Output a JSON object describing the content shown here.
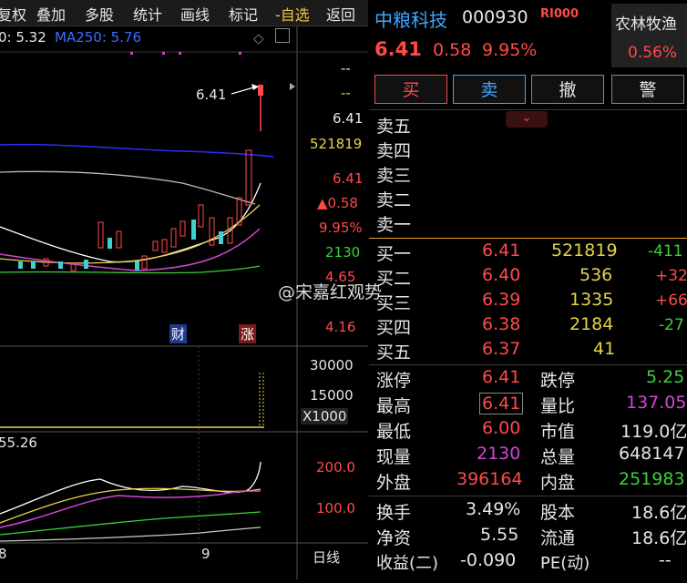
{
  "toolbar": {
    "items": [
      "复权",
      "叠加",
      "多股",
      "统计",
      "画线",
      "标记",
      "-自选",
      "返回"
    ]
  },
  "ma_legend": {
    "ma_partial": "0: 5.32",
    "ma250": "MA250: 5.76"
  },
  "price_axis": [
    "--",
    "--",
    "6.41",
    "521819",
    "6.41",
    "▲0.58",
    "9.95%",
    "2130",
    "4.65",
    "4.16"
  ],
  "kline": {
    "peak_label": "6.41",
    "badge_cai": "财",
    "badge_zhang": "涨"
  },
  "volume_axis": [
    "30000",
    "15000",
    "X1000"
  ],
  "indicator": {
    "value": "55.26",
    "axis": [
      "200.0",
      "100.0"
    ]
  },
  "x_axis": {
    "left": "8",
    "mid": "9",
    "period": "日线"
  },
  "stock": {
    "name": "中粮科技",
    "code": "000930",
    "flag": "R",
    "price": "6.41",
    "change": "0.58",
    "change_pct": "9.95%",
    "sector": "农林牧渔",
    "sector_pct": "0.56%"
  },
  "actions": [
    "买",
    "卖",
    "撤",
    "警"
  ],
  "sell_book": [
    "卖五",
    "卖四",
    "卖三",
    "卖二",
    "卖一"
  ],
  "buy_book": [
    {
      "label": "买一",
      "price": "6.41",
      "vol": "521819",
      "delta": "-411"
    },
    {
      "label": "买二",
      "price": "6.40",
      "vol": "536",
      "delta": "+32"
    },
    {
      "label": "买三",
      "price": "6.39",
      "vol": "1335",
      "delta": "+66"
    },
    {
      "label": "买四",
      "price": "6.38",
      "vol": "2184",
      "delta": "-27"
    },
    {
      "label": "买五",
      "price": "6.37",
      "vol": "41",
      "delta": ""
    }
  ],
  "stats": [
    {
      "l1": "涨停",
      "v1": "6.41",
      "l2": "跌停",
      "v2": "5.25"
    },
    {
      "l1": "最高",
      "v1": "6.41",
      "l2": "量比",
      "v2": "137.05"
    },
    {
      "l1": "最低",
      "v1": "6.00",
      "l2": "市值",
      "v2": "119.0亿"
    },
    {
      "l1": "现量",
      "v1": "2130",
      "l2": "总量",
      "v2": "648147"
    },
    {
      "l1": "外盘",
      "v1": "396164",
      "l2": "内盘",
      "v2": "251983"
    }
  ],
  "fundamentals": [
    {
      "l1": "换手",
      "v1": "3.49%",
      "l2": "股本",
      "v2": "18.6亿"
    },
    {
      "l1": "净资",
      "v1": "5.55",
      "l2": "流通",
      "v2": "18.6亿"
    },
    {
      "l1": "收益(二)",
      "v1": "-0.090",
      "l2": "PE(动)",
      "v2": "--"
    }
  ],
  "watermark": "@宋嘉红观势",
  "colors": {
    "up": "#ff4a4a",
    "down": "#3ad13a",
    "accent": "#e6d24a",
    "purple": "#d445d4",
    "stock_name": "#3fa6ff"
  }
}
